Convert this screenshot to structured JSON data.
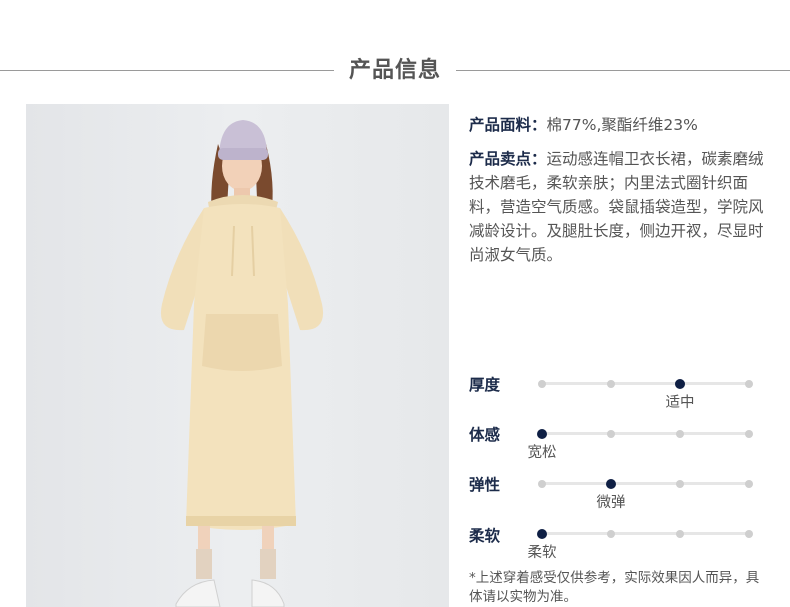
{
  "section_title": "产品信息",
  "fabric": {
    "label": "产品面料：",
    "value": "棉77%,聚酯纤维23%"
  },
  "selling": {
    "label": "产品卖点：",
    "value": "运动感连帽卫衣长裙，碳素磨绒技术磨毛，柔软亲肤；内里法式圈针织面料，营造空气质感。袋鼠插袋造型，学院风减龄设计。及腿肚长度，侧边开衩，尽显时尚淑女气质。"
  },
  "attributes": [
    {
      "name": "厚度",
      "level": 3,
      "value_text": "适中"
    },
    {
      "name": "体感",
      "level": 1,
      "value_text": "宽松"
    },
    {
      "name": "弹性",
      "level": 2,
      "value_text": "微弹"
    },
    {
      "name": "柔软",
      "level": 1,
      "value_text": "柔软"
    }
  ],
  "attribute_scale_steps": 4,
  "note": "*上述穿着感受仅供参考，实际效果因人而异，具体请以实物为准。",
  "colors": {
    "accent": "#0f1f44",
    "label": "#1c2b4a",
    "dress": "#f3e2bd",
    "beanie": "#c9c0d6"
  }
}
